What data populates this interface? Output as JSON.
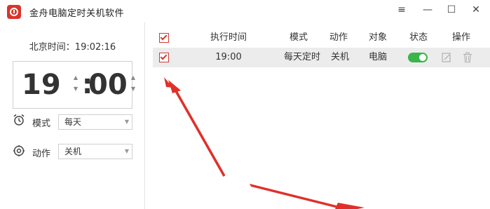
{
  "window": {
    "title": "金舟电脑定时关机软件",
    "controls": {
      "menu": "≡",
      "minimize": "—",
      "maximize": "☐",
      "close": "✕"
    }
  },
  "left": {
    "beijing_time": "北京时间：19:02:16",
    "timer": {
      "hour": "19",
      "colon": ":",
      "minute": "00"
    },
    "mode": {
      "label": "模式",
      "value": "每天"
    },
    "action": {
      "label": "动作",
      "value": "关机"
    }
  },
  "table": {
    "headers": {
      "exec_time": "执行时间",
      "mode": "模式",
      "action": "动作",
      "target": "对象",
      "status": "状态",
      "ops": "操作"
    },
    "rows": [
      {
        "exec_time": "19:00",
        "mode": "每天定时",
        "action": "关机",
        "target": "电脑",
        "status_on": true,
        "checked": true
      }
    ]
  },
  "colors": {
    "accent_red": "#d23a32",
    "toggle_green": "#3bb44a",
    "row_bg": "#ececec"
  },
  "icons": [
    "app-clock-icon",
    "menu-icon",
    "minimize-icon",
    "maximize-icon",
    "close-icon",
    "alarm-clock-icon",
    "gear-icon",
    "edit-icon",
    "trash-icon"
  ]
}
